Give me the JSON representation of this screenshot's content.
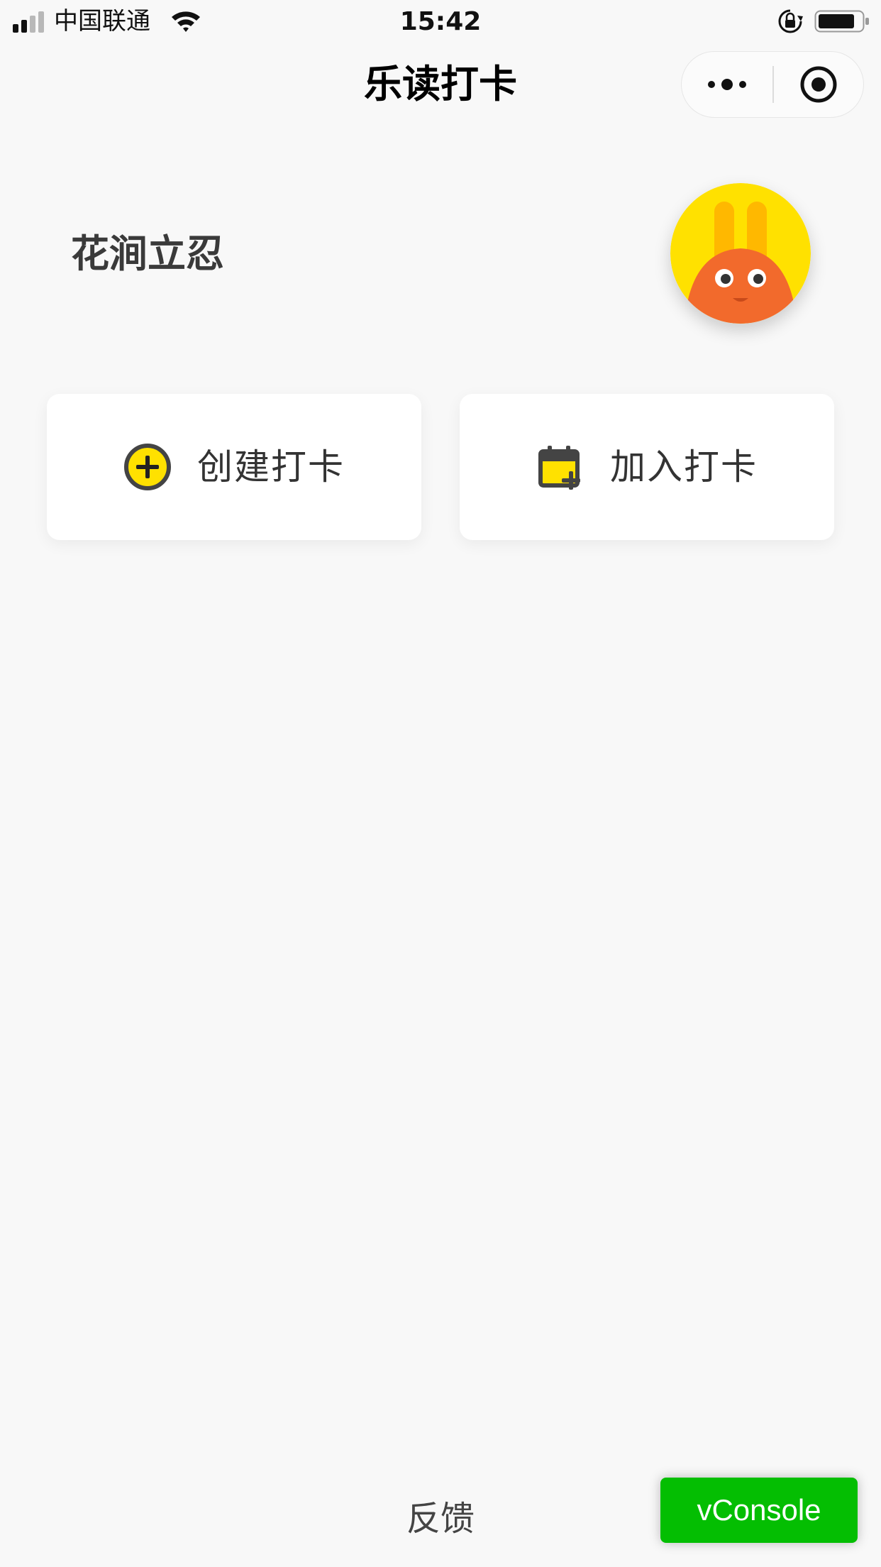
{
  "status_bar": {
    "carrier": "中国联通",
    "time": "15:42",
    "signal_icon": "signal-icon",
    "wifi_icon": "wifi-icon",
    "lock_icon": "orientation-lock-icon",
    "battery_icon": "battery-icon"
  },
  "nav": {
    "title": "乐读打卡",
    "more_icon": "more-dots-icon",
    "close_icon": "close-miniprogram-icon"
  },
  "profile": {
    "name": "花涧立忍",
    "avatar_icon": "rabbit-avatar"
  },
  "actions": {
    "create_label": "创建打卡",
    "create_icon": "add-circle-icon",
    "join_label": "加入打卡",
    "join_icon": "calendar-add-icon"
  },
  "footer": {
    "feedback_label": "反馈",
    "vconsole_label": "vConsole"
  },
  "colors": {
    "background": "#f8f8f8",
    "accent_yellow": "#ffe100",
    "vconsole_green": "#04be02",
    "avatar_orange": "#f26a2c"
  }
}
